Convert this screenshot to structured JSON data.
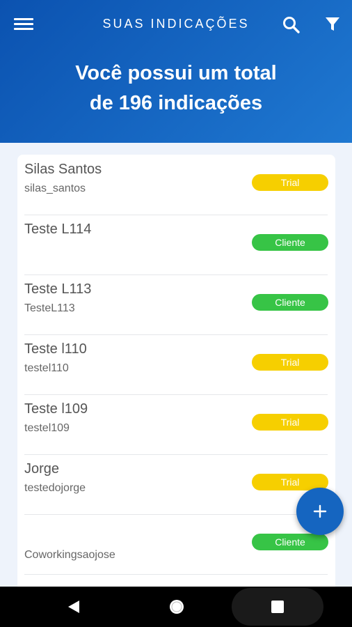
{
  "header": {
    "title": "SUAS INDICAÇÕES",
    "summary_line1": "Você possui um total",
    "summary_line2": "de 196 indicações"
  },
  "colors": {
    "header_blue": "#0b52b0",
    "trial_yellow": "#f6cf00",
    "cliente_green": "#37c446",
    "fab_blue": "#1565c0"
  },
  "icons": {
    "menu": "menu-icon",
    "search": "search-icon",
    "filter": "filter-icon",
    "add": "plus-icon"
  },
  "referrals": [
    {
      "name": "Silas Santos",
      "username": "silas_santos",
      "status": "Trial"
    },
    {
      "name": "Teste L114",
      "username": "",
      "status": "Cliente"
    },
    {
      "name": "Teste L113",
      "username": "TesteL113",
      "status": "Cliente"
    },
    {
      "name": "Teste l110",
      "username": "testel110",
      "status": "Trial"
    },
    {
      "name": "Teste l109",
      "username": "testel109",
      "status": "Trial"
    },
    {
      "name": "Jorge",
      "username": "testedojorge",
      "status": "Trial"
    },
    {
      "name": "",
      "username": "Coworkingsaojose",
      "status": "Cliente"
    }
  ]
}
